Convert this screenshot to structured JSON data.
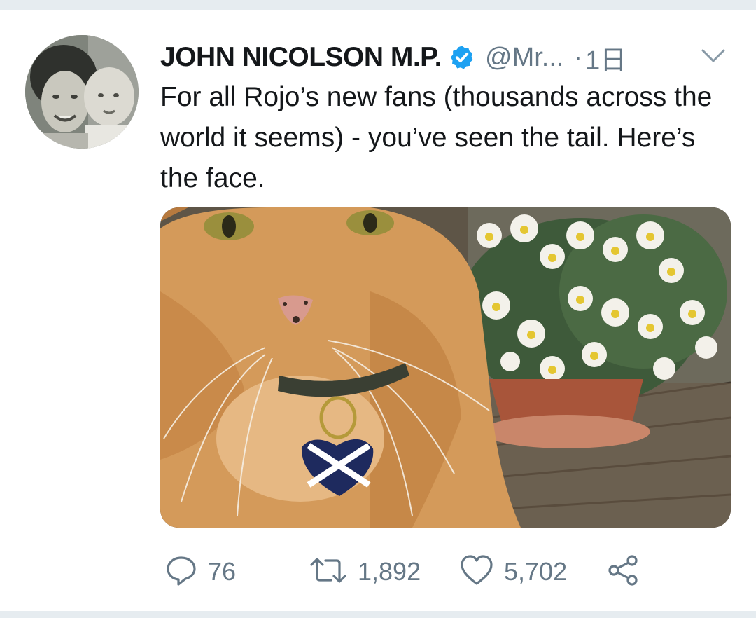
{
  "tweet": {
    "author": {
      "display_name": "JOHN NICOLSON M.P.",
      "handle": "@Mr...",
      "verified": true,
      "avatar_icon": "profile-photo"
    },
    "separator": "·",
    "time": "1日",
    "text": "For all Rojo’s new fans (thousands across the world it seems) - you’ve seen the tail. Here’s the face.",
    "media": {
      "type": "photo",
      "subject": "orange-tabby-cat-with-saltire-heart-tag"
    },
    "actions": {
      "reply_icon": "reply-icon",
      "reply_count": "76",
      "retweet_icon": "retweet-icon",
      "retweet_count": "1,892",
      "like_icon": "heart-icon",
      "like_count": "5,702",
      "share_icon": "share-icon"
    }
  },
  "colors": {
    "text_primary": "#14171a",
    "text_secondary": "#657786",
    "verified_blue": "#1da1f2",
    "divider": "#e6ecf0"
  }
}
